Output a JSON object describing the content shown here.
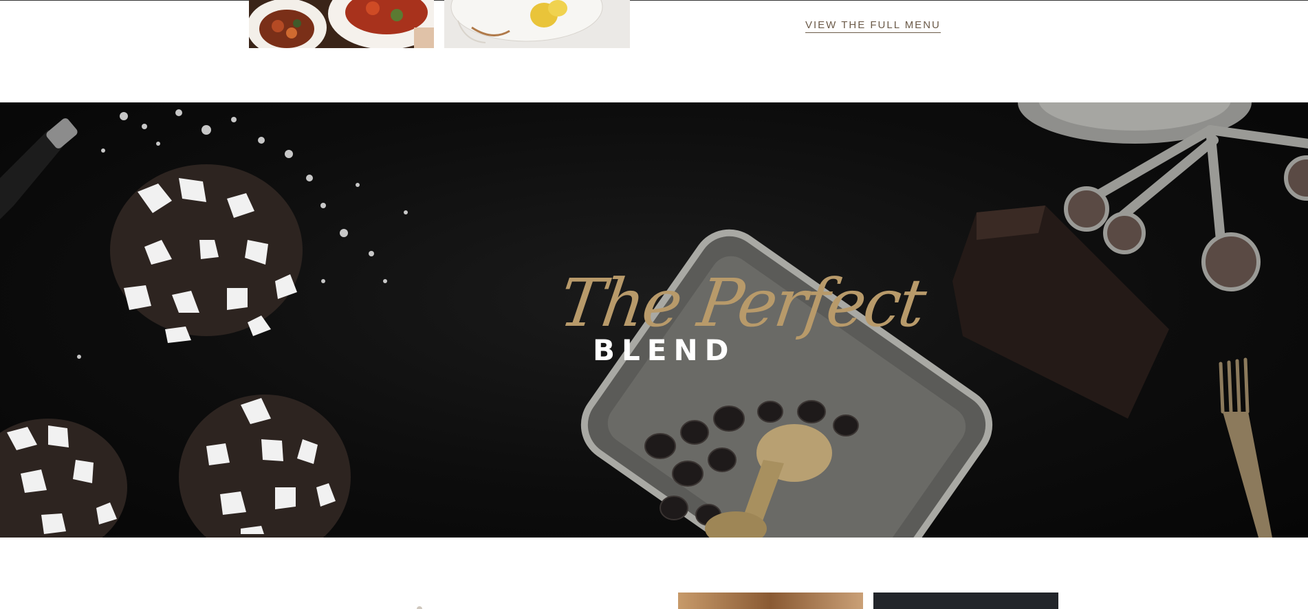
{
  "menu": {
    "link_label": "VIEW THE FULL MENU"
  },
  "hero": {
    "script_text": "The Perfect",
    "strong_text": "BLEND"
  },
  "icons": {
    "food_thumb": "food-photo",
    "lemon_thumb": "lemon-plate-photo",
    "bread_thumb": "bread-photo",
    "dark_thumb": "dark-food-photo"
  }
}
